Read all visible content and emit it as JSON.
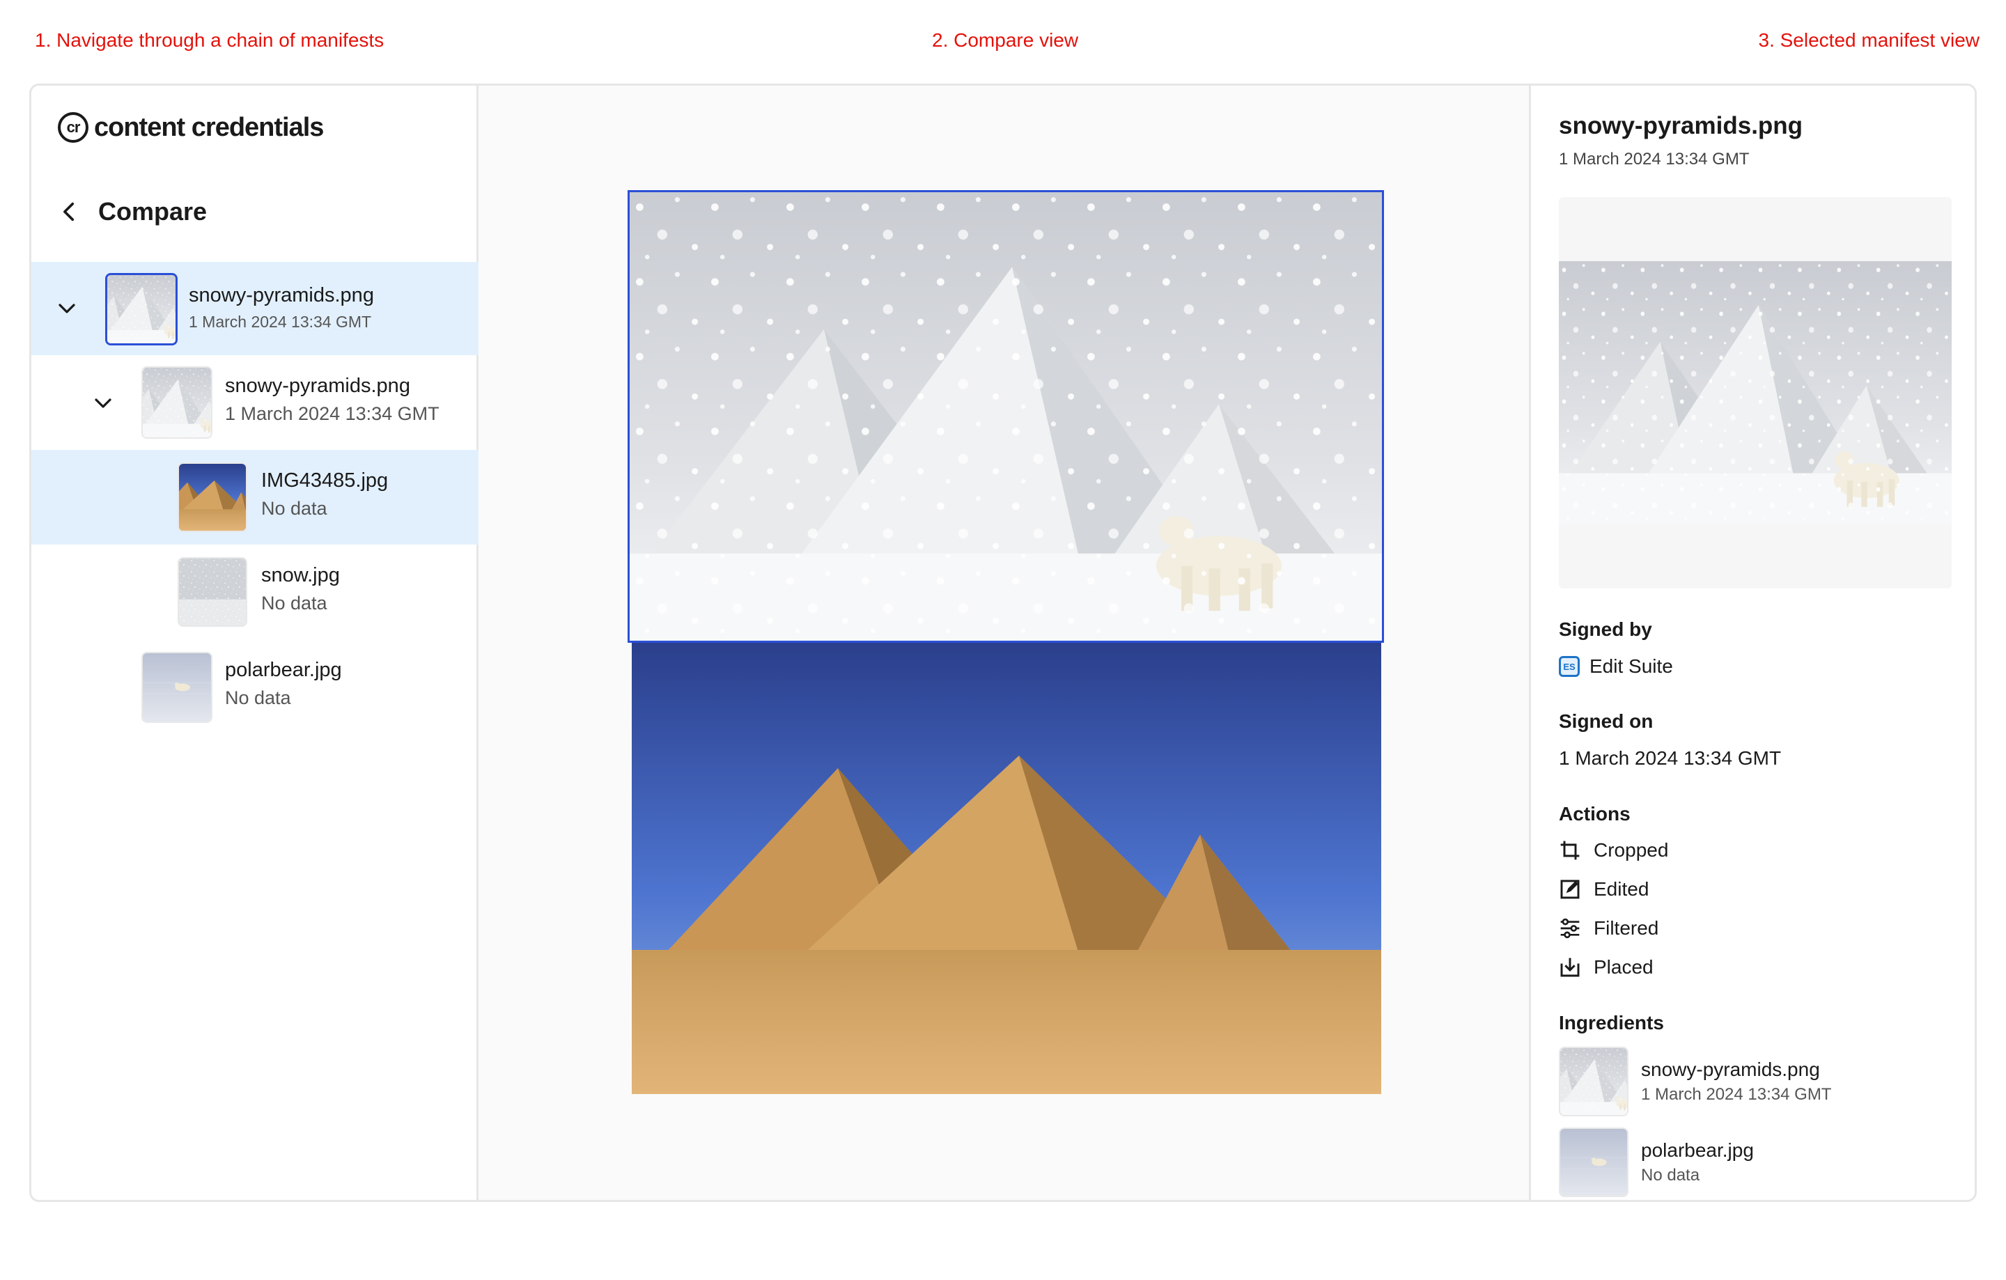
{
  "annotations": {
    "left": "1. Navigate through a chain of manifests",
    "center": "2. Compare view",
    "right": "3. Selected manifest view"
  },
  "app": {
    "logo_mark": "cr",
    "logo_text": "content credentials"
  },
  "nav": {
    "back_label": "Compare"
  },
  "tree": [
    {
      "name": "snowy-pyramids.png",
      "sub": "1 March 2024 13:34 GMT",
      "thumb": "snowy-pyramids-thumbnail"
    },
    {
      "name": "snowy-pyramids.png",
      "sub": "1 March 2024 13:34 GMT",
      "thumb": "snowy-pyramids-thumbnail"
    },
    {
      "name": "IMG43485.jpg",
      "sub": "No data",
      "thumb": "desert-pyramids-thumbnail"
    },
    {
      "name": "snow.jpg",
      "sub": "No data",
      "thumb": "snow-thumbnail"
    },
    {
      "name": "polarbear.jpg",
      "sub": "No data",
      "thumb": "polarbear-thumbnail"
    }
  ],
  "details": {
    "title": "snowy-pyramids.png",
    "date": "1 March 2024 13:34 GMT",
    "signed_by_label": "Signed by",
    "signed_by_badge": "ES",
    "signed_by": "Edit Suite",
    "signed_on_label": "Signed on",
    "signed_on": "1 March 2024 13:34 GMT",
    "actions_label": "Actions",
    "actions": [
      {
        "label": "Cropped",
        "icon": "crop-icon"
      },
      {
        "label": "Edited",
        "icon": "edit-icon"
      },
      {
        "label": "Filtered",
        "icon": "filter-icon"
      },
      {
        "label": "Placed",
        "icon": "place-icon"
      }
    ],
    "ingredients_label": "Ingredients",
    "ingredients": [
      {
        "name": "snowy-pyramids.png",
        "sub": "1 March 2024 13:34 GMT"
      },
      {
        "name": "polarbear.jpg",
        "sub": "No data"
      }
    ]
  },
  "colors": {
    "accent": "#2b4fd6",
    "selected_row": "#e2f0fd",
    "annotation": "#e3120b"
  }
}
